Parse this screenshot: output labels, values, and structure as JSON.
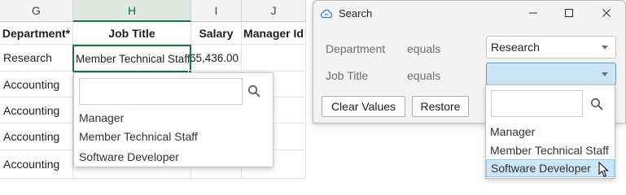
{
  "sheet": {
    "columns": [
      "G",
      "H",
      "I",
      "J"
    ],
    "headers": [
      "Department*",
      "Job Title",
      "Salary",
      "Manager Id"
    ],
    "rows": [
      {
        "department": "Research",
        "job_title": "Member Technical Staff",
        "salary": "65,436.00",
        "manager_id": ""
      },
      {
        "department": "Accounting"
      },
      {
        "department": "Accounting"
      },
      {
        "department": "Accounting"
      },
      {
        "department": "Accounting"
      }
    ],
    "dropdown": {
      "search_placeholder": "",
      "options": [
        "Manager",
        "Member Technical Staff",
        "Software Developer"
      ]
    }
  },
  "dialog": {
    "title": "Search",
    "filters": [
      {
        "field": "Department",
        "operator": "equals",
        "value": "Research"
      },
      {
        "field": "Job Title",
        "operator": "equals",
        "value": ""
      }
    ],
    "buttons": {
      "clear": "Clear Values",
      "restore": "Restore"
    },
    "dropdown": {
      "search_placeholder": "",
      "options": [
        "Manager",
        "Member Technical Staff",
        "Software Developer"
      ],
      "hovered_index": 2
    }
  },
  "colors": {
    "accent_green": "#217346",
    "focus_blue": "#cde6f7",
    "hover_border": "#99c9ef"
  },
  "icons": [
    "search-icon",
    "cloud-app-icon",
    "minimize-icon",
    "maximize-icon",
    "close-icon",
    "chevron-down-icon",
    "mouse-cursor-icon"
  ]
}
